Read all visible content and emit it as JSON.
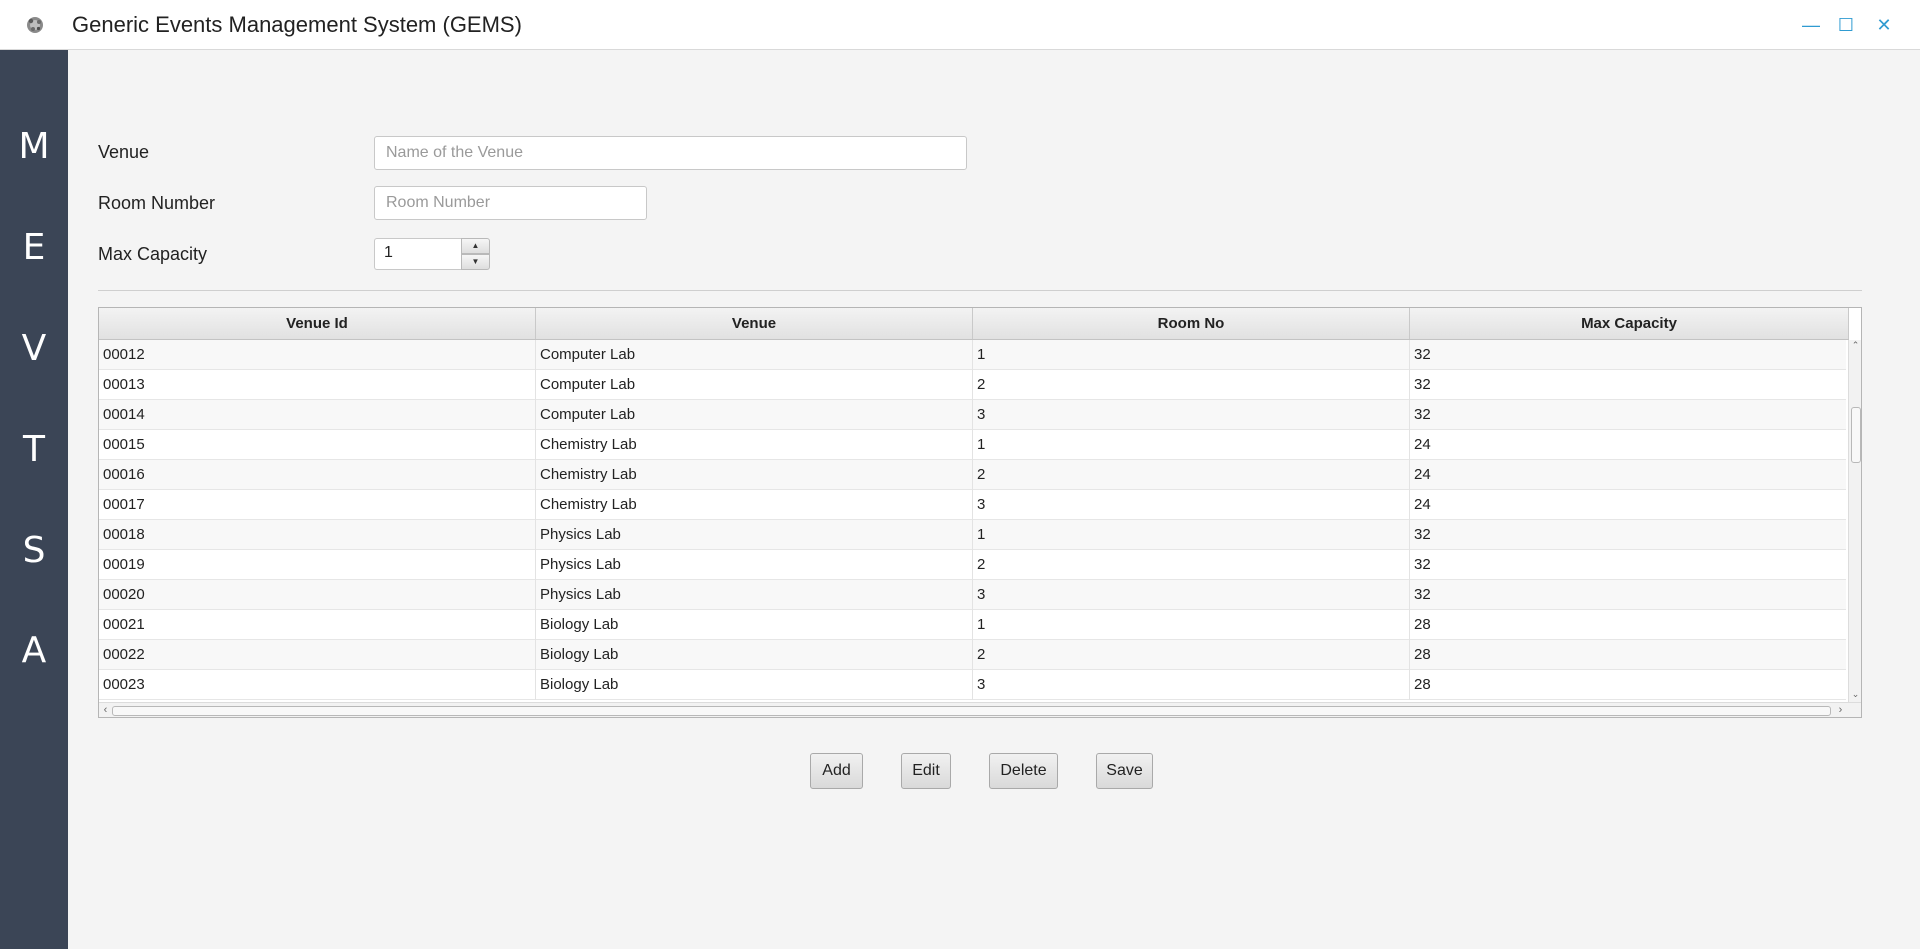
{
  "window": {
    "title": "Generic Events Management System (GEMS)",
    "icon": "gear-cluster-logo",
    "controls": {
      "minimize": "—",
      "maximize": "☐",
      "close": "✕"
    },
    "accent_color": "#2f9bd1"
  },
  "sidebar": {
    "background": "#3b4556",
    "letters": [
      "M",
      "E",
      "V",
      "T",
      "S",
      "A"
    ]
  },
  "form": {
    "venue": {
      "label": "Venue",
      "placeholder": "Name of the Venue",
      "value": ""
    },
    "room_number": {
      "label": "Room Number",
      "placeholder": "Room Number",
      "value": ""
    },
    "max_capacity": {
      "label": "Max Capacity",
      "value": "1"
    }
  },
  "table": {
    "columns": [
      "Venue Id",
      "Venue",
      "Room No",
      "Max Capacity"
    ],
    "rows": [
      [
        "00012",
        "Computer Lab",
        "1",
        "32"
      ],
      [
        "00013",
        "Computer Lab",
        "2",
        "32"
      ],
      [
        "00014",
        "Computer Lab",
        "3",
        "32"
      ],
      [
        "00015",
        "Chemistry Lab",
        "1",
        "24"
      ],
      [
        "00016",
        "Chemistry Lab",
        "2",
        "24"
      ],
      [
        "00017",
        "Chemistry Lab",
        "3",
        "24"
      ],
      [
        "00018",
        "Physics Lab",
        "1",
        "32"
      ],
      [
        "00019",
        "Physics Lab",
        "2",
        "32"
      ],
      [
        "00020",
        "Physics Lab",
        "3",
        "32"
      ],
      [
        "00021",
        "Biology Lab",
        "1",
        "28"
      ],
      [
        "00022",
        "Biology Lab",
        "2",
        "28"
      ],
      [
        "00023",
        "Biology Lab",
        "3",
        "28"
      ]
    ]
  },
  "actions": {
    "add": "Add",
    "edit": "Edit",
    "delete": "Delete",
    "save": "Save"
  }
}
